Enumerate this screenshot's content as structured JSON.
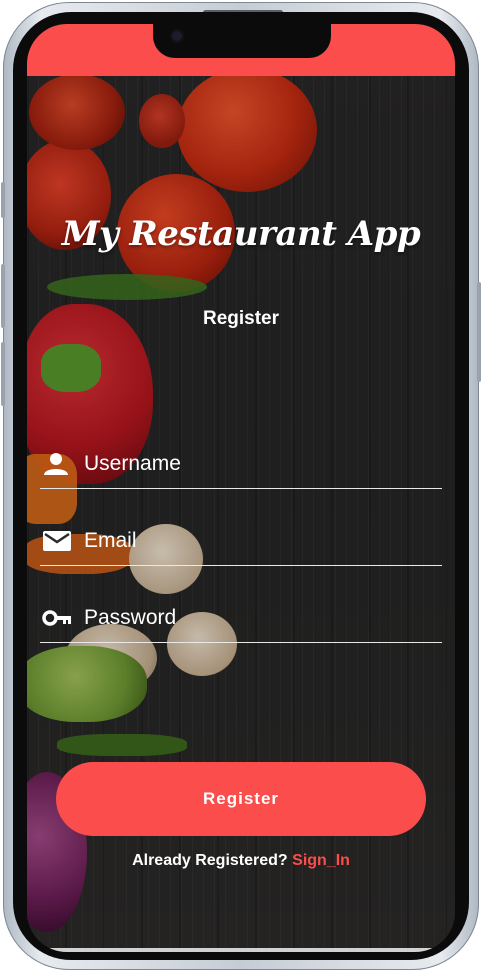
{
  "colors": {
    "accent": "#fb4d4b",
    "text": "#ffffff",
    "background": "#2b2a29"
  },
  "app": {
    "title": "My Restaurant App",
    "subtitle": "Register"
  },
  "form": {
    "fields": [
      {
        "icon": "person-icon",
        "placeholder": "Username"
      },
      {
        "icon": "mail-icon",
        "placeholder": "Email"
      },
      {
        "icon": "key-icon",
        "placeholder": "Password"
      }
    ]
  },
  "actions": {
    "register_label": "Register"
  },
  "footer": {
    "question": "Already Registered?",
    "link_label": "Sign_In"
  }
}
